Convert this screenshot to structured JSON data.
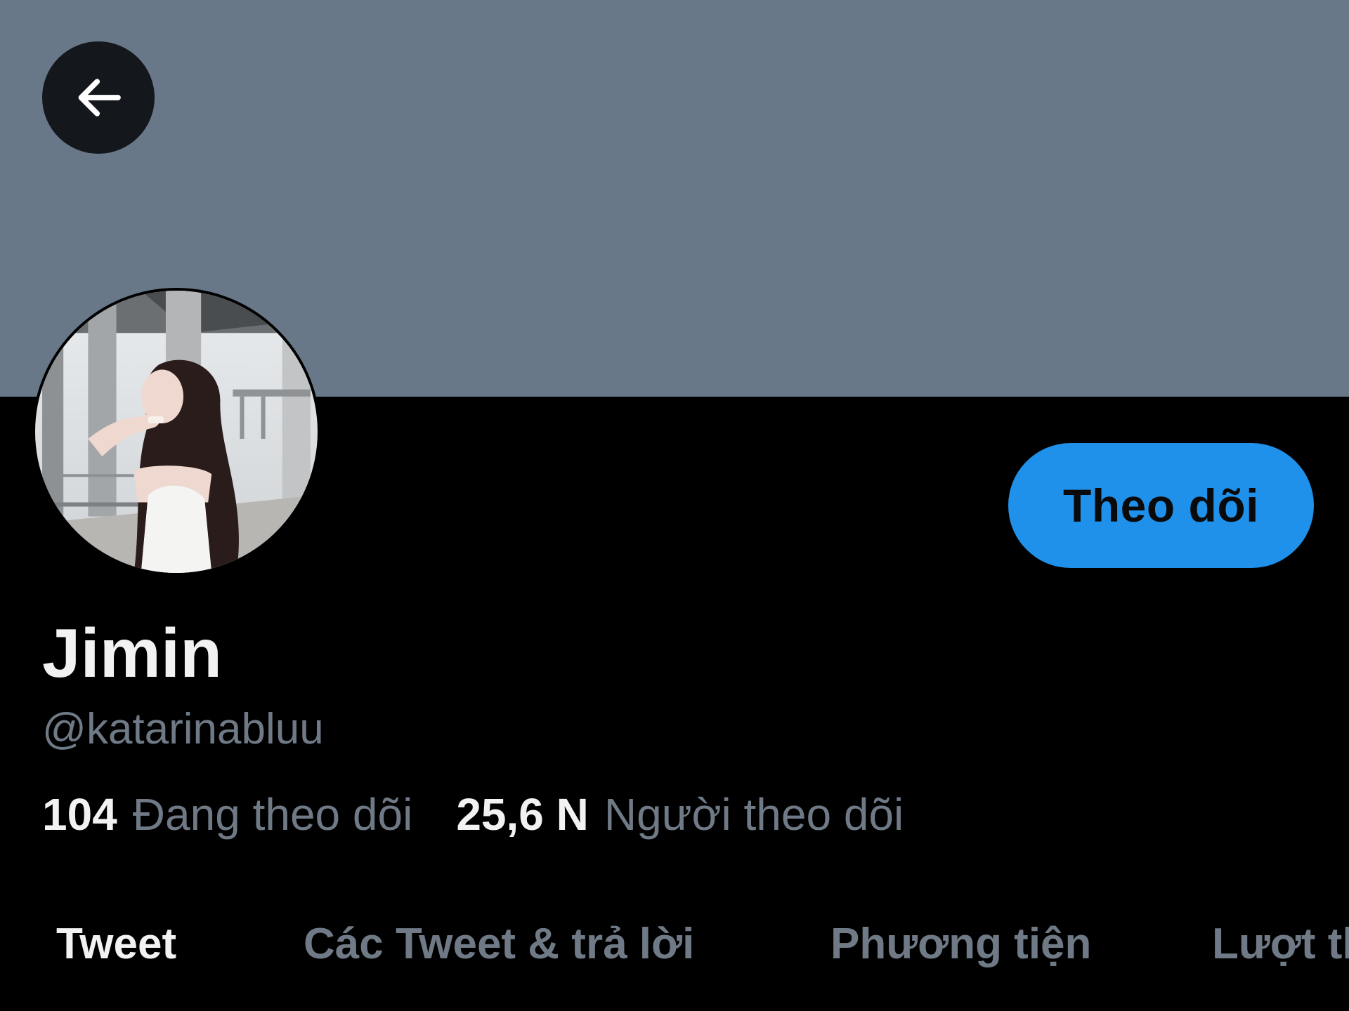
{
  "header": {
    "back_icon": "arrow-left-icon",
    "banner_color": "#687889"
  },
  "profile": {
    "avatar_icon": "profile-photo",
    "display_name": "Jimin",
    "handle": "@katarinabluu",
    "follow_label": "Theo dõi",
    "follow_color": "#2091ea"
  },
  "stats": {
    "following_count": "104",
    "following_label": "Đang theo dõi",
    "followers_count": "25,6 N",
    "followers_label": "Người theo dõi"
  },
  "tabs": [
    {
      "label": "Tweet",
      "active": true
    },
    {
      "label": "Các Tweet & trả lời",
      "active": false
    },
    {
      "label": "Phương tiện",
      "active": false
    },
    {
      "label": "Lượt thích",
      "active": false
    }
  ]
}
